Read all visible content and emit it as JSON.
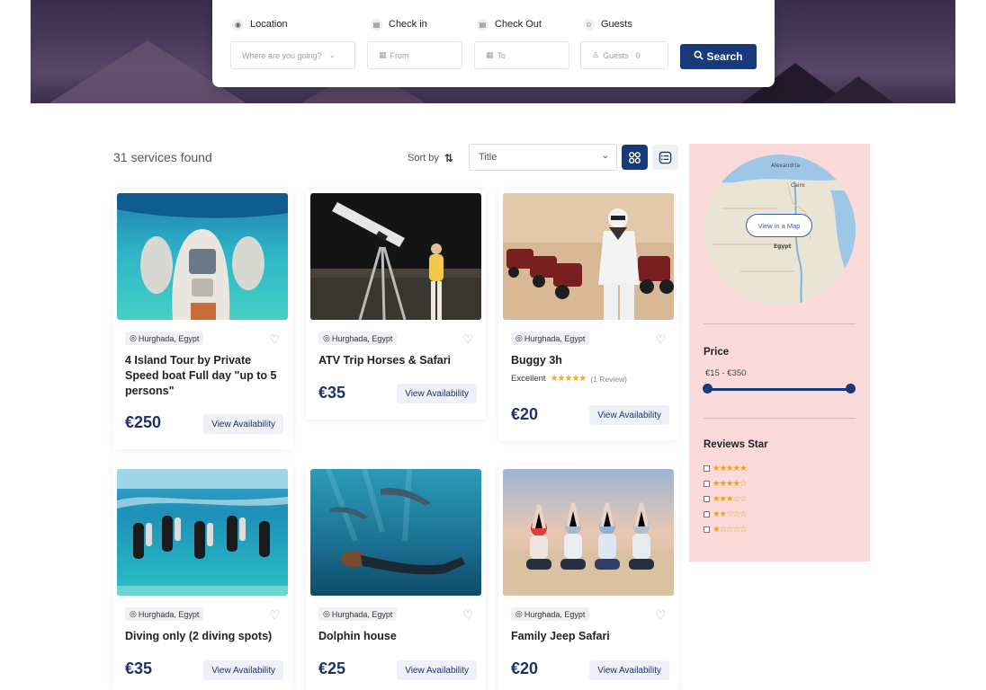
{
  "search": {
    "location_label": "Location",
    "checkin_label": "Check in",
    "checkout_label": "Check Out",
    "guests_label": "Guests",
    "location_placeholder": "Where are you going?",
    "from_placeholder": "From",
    "to_placeholder": "To",
    "guests_placeholder": "Guests",
    "guests_value": "0",
    "button_label": "Search"
  },
  "toolbar": {
    "results_count": "31 services found",
    "sort_label": "Sort by",
    "sort_value": "Title"
  },
  "cards": [
    {
      "location": "Hurghada, Egypt",
      "title": "4 Island Tour by Private Speed boat Full day \"up to 5 persons\"",
      "price": "€250",
      "action": "View Availability"
    },
    {
      "location": "Hurghada, Egypt",
      "title": "ATV Trip Horses & Safari",
      "price": "€35",
      "action": "View Availability"
    },
    {
      "location": "Hurghada, Egypt",
      "title": "Buggy 3h",
      "rating_label": "Excellent",
      "rating_stars": 5,
      "reviews": "(1 Review)",
      "price": "€20",
      "action": "View Availability"
    },
    {
      "location": "Hurghada, Egypt",
      "title": "Diving only (2 diving spots)",
      "price": "€35",
      "action": "View Availability"
    },
    {
      "location": "Hurghada, Egypt",
      "title": "Dolphin house",
      "price": "€25",
      "action": "View Availability"
    },
    {
      "location": "Hurghada, Egypt",
      "title": "Family Jeep Safari",
      "price": "€20",
      "action": "View Availability"
    }
  ],
  "sidebar": {
    "map_button": "View in a Map",
    "map_labels": {
      "country": "Egypt",
      "city": "Alexandria",
      "capital": "Cairo"
    },
    "price_heading": "Price",
    "price_range": "€15 - €350",
    "price_min": 15,
    "price_max": 350,
    "reviews_heading": "Reviews Star",
    "star_filters": [
      5,
      4,
      3,
      2,
      1
    ]
  },
  "colors": {
    "brand": "#173b7a",
    "sidebar_bg": "#fbdada",
    "star": "#f5a623"
  }
}
